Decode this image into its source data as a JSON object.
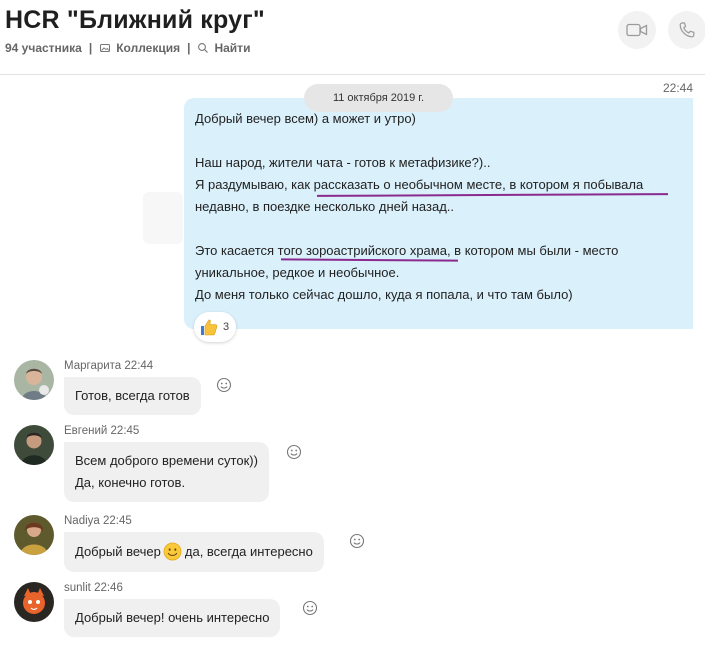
{
  "header": {
    "title": "HCR \"Ближний круг\"",
    "members": "94 участника",
    "collection_label": "Коллекция",
    "search_label": "Найти"
  },
  "conversation": {
    "date_divider": "11 октября 2019 г.",
    "my_message": {
      "time": "22:44",
      "lines": [
        "Добрый вечер всем) а может и утро)",
        "",
        "Наш народ, жители чата - готов к метафизике?)..",
        "Я раздумываю, как рассказать о необычном месте, в котором я побывала",
        "недавно, в поездке несколько дней назад..",
        "",
        "Это касается того зороастрийского храма, в котором мы были - место",
        "уникальное, редкое и необычное.",
        "До меня только сейчас дошло, куда я попала, и что там было)"
      ],
      "reaction": {
        "icon": "thumbs-up-icon",
        "count": "3"
      }
    },
    "messages": [
      {
        "author": "Маргарита",
        "time": "22:44",
        "text": "Готов, всегда готов"
      },
      {
        "author": "Евгений",
        "time": "22:45",
        "lines": [
          "Всем доброго времени суток))",
          "Да, конечно готов."
        ]
      },
      {
        "author": "Nadiya",
        "time": "22:45",
        "text_before": "Добрый вечер",
        "emoji": "smile-emoji",
        "text_after": "да, всегда интересно"
      },
      {
        "author": "sunlit",
        "time": "22:46",
        "text": "Добрый вечер! очень интересно"
      }
    ]
  },
  "colors": {
    "my_bubble": "#daf0fb",
    "other_bubble": "#f0f0f0",
    "underline": "#8a2a8f"
  }
}
